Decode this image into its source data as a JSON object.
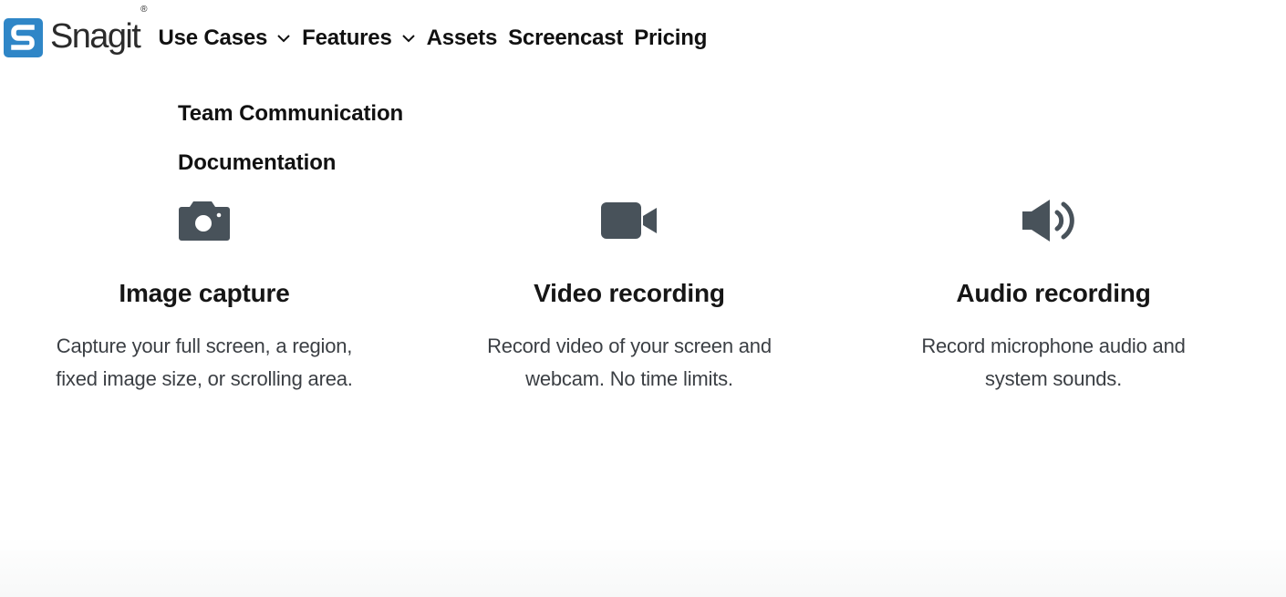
{
  "brand": {
    "name": "Snagit",
    "reg": "®",
    "color": "#2f86c7"
  },
  "nav": {
    "items": [
      {
        "label": "Use Cases",
        "has_dropdown": true
      },
      {
        "label": "Features",
        "has_dropdown": true
      },
      {
        "label": "Assets",
        "has_dropdown": false
      },
      {
        "label": "Screencast",
        "has_dropdown": false
      },
      {
        "label": "Pricing",
        "has_dropdown": false
      }
    ]
  },
  "use_cases_menu": {
    "items": [
      {
        "label": "Team Communication"
      },
      {
        "label": "Documentation"
      }
    ]
  },
  "features": [
    {
      "icon": "camera-icon",
      "title": "Image capture",
      "desc_line1": "Capture your full screen, a region,",
      "desc_line2": "fixed image size, or scrolling area."
    },
    {
      "icon": "video-camera-icon",
      "title": "Video recording",
      "desc_line1": "Record video of your screen and",
      "desc_line2": "webcam. No time limits."
    },
    {
      "icon": "speaker-icon",
      "title": "Audio recording",
      "desc_line1": "Record microphone audio and",
      "desc_line2": "system sounds."
    }
  ],
  "colors": {
    "icon": "#48525a",
    "text": "#121212",
    "muted": "#3b3f44"
  }
}
